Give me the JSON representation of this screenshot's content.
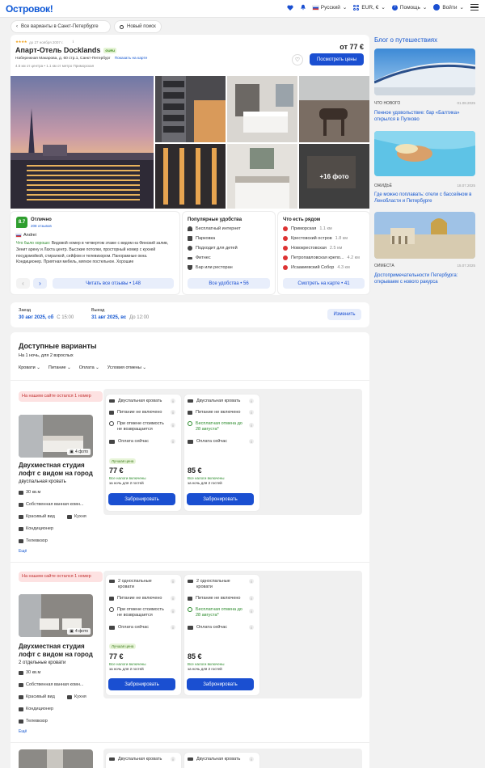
{
  "header": {
    "logo": "Островок!",
    "language": "Русский",
    "currency": "EUR, €",
    "help": "Помощь",
    "login": "Войти"
  },
  "top_nav": {
    "back_label": "Все варианты в Санкт-Петербурге",
    "new_search_label": "Новый поиск"
  },
  "hotel": {
    "stars_note": "до 27 ноября 2007 г.",
    "name": "Апарт-Отель Docklands",
    "guru": "GURU",
    "address": "Набережная Макарова, д. 60 стр.1, Санкт-Петербург",
    "show_map": "Показать на карте",
    "distances": "4.5 км от центра • 1.1 км от метро Приморская",
    "price": "от 77 €",
    "see_prices": "Посмотреть цены",
    "photos_more": "+16 фото"
  },
  "review": {
    "score": "8.7",
    "label": "Отлично",
    "count": "208 отзывов",
    "author": "Andrei",
    "liked_label": "Что было хорошо:",
    "text": "Видовой номер в четвертом этаже с видом на Финский залив, Зенит арену и Лахта центр. Высокие потолки, просторный номер с кухней посудомойкой, стиралкой, сейфом и телевизором. Панорамные окна. Кондиционер. Приятная мебель, мягкое постельное. Хорошие",
    "read_all": "Читать все отзывы • 148"
  },
  "amenities": {
    "title": "Популярные удобства",
    "items": [
      "Бесплатный интернет",
      "Парковка",
      "Подходит для детей",
      "Фитнес",
      "Бар или ресторан"
    ],
    "all_label": "Все удобства • 56"
  },
  "nearby": {
    "title": "Что есть рядом",
    "items": [
      {
        "name": "Приморская",
        "dist": "1.1 км"
      },
      {
        "name": "Крестовский остров",
        "dist": "1.8 км"
      },
      {
        "name": "Новокрестовская",
        "dist": "2.5 км"
      },
      {
        "name": "Петропавловская крепо...",
        "dist": "4.2 км"
      },
      {
        "name": "Исаакиевский Собор",
        "dist": "4.3 км"
      }
    ],
    "map_label": "Смотреть на карте • 41"
  },
  "dates": {
    "checkin_label": "Заезд",
    "checkin": "30 авг 2025, сб",
    "checkin_time": "С 15:00",
    "checkout_label": "Выезд",
    "checkout": "31 авг 2025, вс",
    "checkout_time": "До 12:00",
    "change": "Изменить"
  },
  "available": {
    "title": "Доступные варианты",
    "subtitle": "На 1 ночь, для 2 взрослых",
    "filters": [
      "Кровати",
      "Питание",
      "Оплата",
      "Условия отмены"
    ]
  },
  "rooms": [
    {
      "alert": "На нашем сайте остался 1 номер",
      "photos": "4 фото",
      "name": "Двухместная студия лофт с видом на город",
      "bed": "двуспальная кровать",
      "features": [
        "30 кв.м",
        "Собственная ванная комн...",
        "Красивый вид",
        "Кухня",
        "Кондиционер",
        "Телевизор"
      ],
      "more": "Ещё",
      "options": [
        {
          "bed": "Двуспальная кровать",
          "meal": "Питание не включено",
          "cancel": "При отмене стоимость не возвращается",
          "pay": "Оплата сейчас",
          "tag": "Лучшая цена",
          "price": "77 €",
          "taxes": "Все налоги включены",
          "per": "за ночь для 2 гостей",
          "book": "Забронировать"
        },
        {
          "bed": "Двуспальная кровать",
          "meal": "Питание не включено",
          "cancel": "Бесплатная отмена до 28 августа*",
          "pay": "Оплата сейчас",
          "tag": "",
          "price": "85 €",
          "taxes": "Все налоги включены",
          "per": "за ночь для 2 гостей",
          "book": "Забронировать"
        }
      ]
    },
    {
      "alert": "На нашем сайте остался 1 номер",
      "photos": "4 фото",
      "name": "Двухместная студия лофт с видом на город",
      "bed": "2 отдельные кровати",
      "features": [
        "30 кв.м",
        "Собственная ванная комн...",
        "Красивый вид",
        "Кухня",
        "Кондиционер",
        "Телевизор"
      ],
      "more": "Ещё",
      "options": [
        {
          "bed": "2 односпальные кровати",
          "meal": "Питание не включено",
          "cancel": "При отмене стоимость не возвращается",
          "pay": "Оплата сейчас",
          "tag": "Лучшая цена",
          "price": "77 €",
          "taxes": "Все налоги включены",
          "per": "за ночь для 2 гостей",
          "book": "Забронировать"
        },
        {
          "bed": "2 односпальные кровати",
          "meal": "Питание не включено",
          "cancel": "Бесплатная отмена до 28 августа*",
          "pay": "Оплата сейчас",
          "tag": "",
          "price": "85 €",
          "taxes": "Все налоги включены",
          "per": "за ночь для 2 гостей",
          "book": "Забронировать"
        }
      ]
    },
    {
      "options": [
        {
          "bed": "Двуспальная кровать"
        },
        {
          "bed": "Двуспальная кровать"
        }
      ]
    }
  ],
  "blog": {
    "title": "Блог о путешествиях",
    "posts": [
      {
        "cat": "Что нового",
        "date": "01.08.2025",
        "title": "Пенное удовольствие: бар «Балтика» открылся в Пулково"
      },
      {
        "cat": "Ожидьё",
        "date": "18.07.2025",
        "title": "Где можно поплавать: отели с бассейном в Ленобласти и Петербурге"
      },
      {
        "cat": "Оиместа",
        "date": "15.07.2025",
        "title": "Достопримечательности Петербурга: открываем с нового ракурса"
      }
    ]
  },
  "colors": {
    "brand": "#1a4fd1",
    "score": "#2f9e2f",
    "alert_bg": "#fde2e2"
  }
}
